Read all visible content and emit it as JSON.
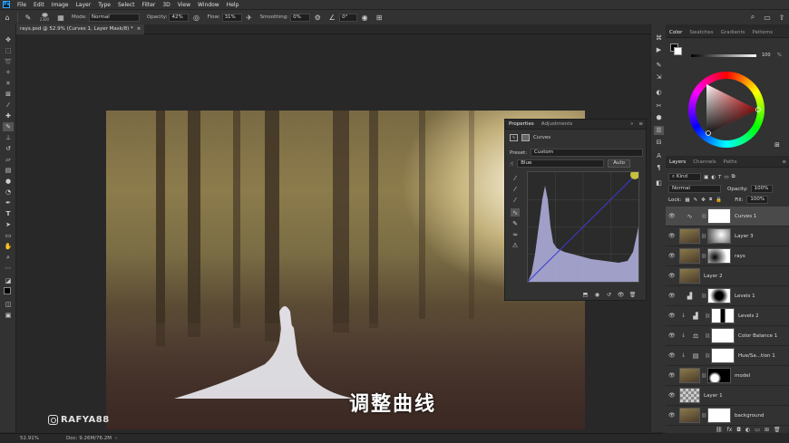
{
  "menu": {
    "app_badge": "Ps",
    "items": [
      "File",
      "Edit",
      "Image",
      "Layer",
      "Type",
      "Select",
      "Filter",
      "3D",
      "View",
      "Window",
      "Help"
    ]
  },
  "options": {
    "brush_size": "2300",
    "mode_label": "Mode:",
    "mode_value": "Normal",
    "opacity_label": "Opacity:",
    "opacity_value": "42%",
    "flow_label": "Flow:",
    "flow_value": "31%",
    "smoothing_label": "Smoothing:",
    "smoothing_value": "0%",
    "angle_value": "0°"
  },
  "document": {
    "tab_title": "rays.psd @ 52.9% (Curves 1, Layer Mask/8) *",
    "tab_close": "×"
  },
  "overlay": {
    "watermark": "RAFYA88",
    "subtitle": "调整曲线"
  },
  "properties": {
    "tabs": [
      "Properties",
      "Adjustments"
    ],
    "type_label": "Curves",
    "preset_label": "Preset:",
    "preset_value": "Custom",
    "channel_value": "Blue",
    "auto_label": "Auto"
  },
  "color_panel": {
    "tabs": [
      "Color",
      "Swatches",
      "Gradients",
      "Patterns"
    ],
    "slider_value": "100",
    "slider_unit": "%"
  },
  "layers_panel": {
    "tabs": [
      "Layers",
      "Channels",
      "Paths"
    ],
    "kind_label": "Kind",
    "blend_mode": "Normal",
    "opacity_label": "Opacity:",
    "opacity_value": "100%",
    "lock_label": "Lock:",
    "fill_label": "Fill:",
    "fill_value": "100%",
    "layers": [
      {
        "name": "Curves 1",
        "kind": "curves",
        "selected": true
      },
      {
        "name": "Layer 3",
        "kind": "pixel"
      },
      {
        "name": "rays",
        "kind": "pixel"
      },
      {
        "name": "Layer 2",
        "kind": "pixel"
      },
      {
        "name": "Levels 1",
        "kind": "levels"
      },
      {
        "name": "Levels 2",
        "kind": "levels"
      },
      {
        "name": "Color Balance 1",
        "kind": "balance"
      },
      {
        "name": "Hue/Sa...tion 1",
        "kind": "hue"
      },
      {
        "name": "model",
        "kind": "pixel"
      },
      {
        "name": "Layer 1",
        "kind": "pixel"
      },
      {
        "name": "background",
        "kind": "pixel"
      }
    ]
  },
  "status": {
    "zoom": "52.91%",
    "doc_info": "Doc: 9.26M/76.2M"
  },
  "colors": {
    "panel": "#323232",
    "accent": "#31a8ff",
    "curve_fill": "#b4b4e4",
    "curve_line": "#3a3ad0"
  }
}
